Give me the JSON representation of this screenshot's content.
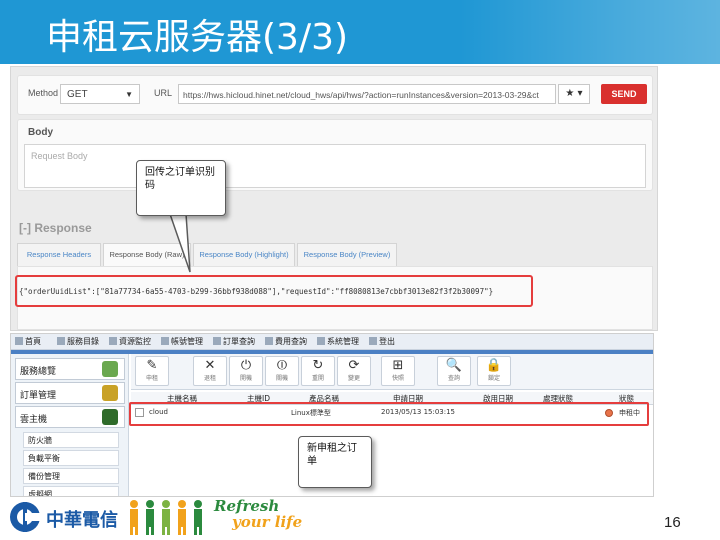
{
  "slide": {
    "title": "申租云服务器(3/3)",
    "page_number": "16"
  },
  "rest_client": {
    "method_label": "Method",
    "method_value": "GET",
    "url_label": "URL",
    "url_value": "https://hws.hicloud.hinet.net/cloud_hws/api/hws/?action=runInstances&version=2013-03-29&ct",
    "star_glyph": "★ ▾",
    "send_label": "SEND",
    "body_label": "Body",
    "body_placeholder": "Request Body",
    "response_title": "[-] Response",
    "tabs": [
      {
        "label": "Response Headers"
      },
      {
        "label": "Response Body (Raw)"
      },
      {
        "label": "Response Body (Highlight)"
      },
      {
        "label": "Response Body (Preview)"
      }
    ],
    "response_body": "{\"orderUuidList\":[\"81a77734-6a55-4703-b299-36bbf938d088\"],\"requestId\":\"ff8080813e7cbbf3013e82f3f2b30097\"}"
  },
  "callouts": {
    "top": "回传之订单识别码",
    "bottom": "新申租之订单"
  },
  "portal": {
    "menu": [
      "首頁",
      "服務目錄",
      "資源監控",
      "帳號管理",
      "訂單查詢",
      "費用查詢",
      "系統管理",
      "登出"
    ],
    "sidebar_groups": [
      "服務總覽",
      "訂單管理",
      "雲主機"
    ],
    "sidebar_items": [
      "防火牆",
      "負載平衡",
      "備份管理",
      "虛擬網"
    ],
    "toolbar": [
      {
        "glyph": "✎",
        "label": "申租"
      },
      {
        "glyph": "✕",
        "label": "退租"
      },
      {
        "glyph": "⏻",
        "label": "開機"
      },
      {
        "glyph": "⏼",
        "label": "關機"
      },
      {
        "glyph": "↻",
        "label": "重開"
      },
      {
        "glyph": "⟳",
        "label": "變更"
      },
      {
        "glyph": "⊞",
        "label": "快照"
      },
      {
        "glyph": "🔍",
        "label": "查詢"
      },
      {
        "glyph": "🔒",
        "label": "鎖定"
      }
    ],
    "columns": [
      "主機名稱",
      "主機ID",
      "產品名稱",
      "申請日期",
      "啟用日期",
      "處理狀態",
      "狀態"
    ],
    "row": {
      "host_name": "cloud",
      "host_id": "",
      "product": "Linux標準型",
      "apply_date": "2013/05/13 15:03:15",
      "start_date": "",
      "process_status": "",
      "state": "申租中"
    }
  },
  "footer": {
    "company": "中華電信",
    "slogan_1": "Refresh",
    "slogan_2": "your life"
  }
}
